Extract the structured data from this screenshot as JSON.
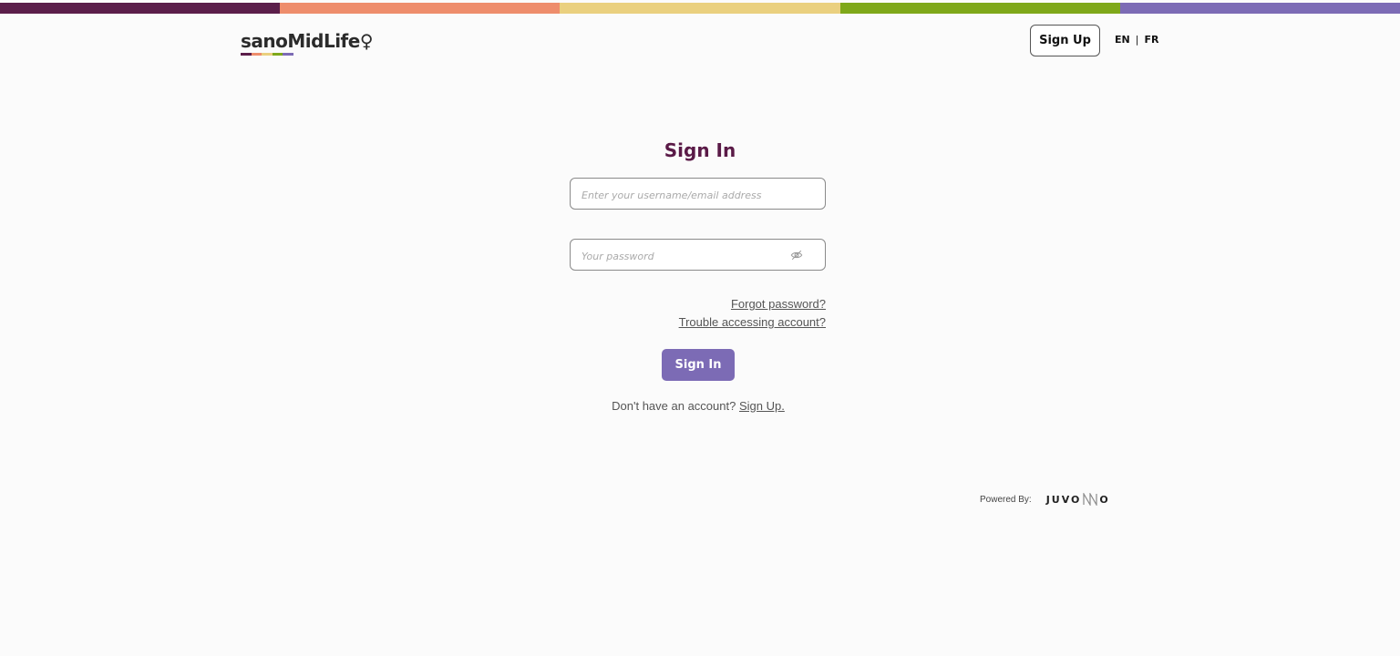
{
  "colors": {
    "stripe": [
      "#5b1e4a",
      "#ee8d6c",
      "#ead07f",
      "#7fa81a",
      "#7c6bb5"
    ],
    "title": "#5a1a47",
    "button": "#7c6bb5"
  },
  "header": {
    "logo_text": "sanoMidLife",
    "logo_symbol": "♀",
    "signup_label": "Sign Up",
    "lang_en": "EN",
    "lang_sep": "|",
    "lang_fr": "FR"
  },
  "form": {
    "title": "Sign In",
    "username_placeholder": "Enter your username/email address",
    "password_placeholder": "Your password",
    "forgot_password": "Forgot password?",
    "trouble_access": "Trouble accessing account?",
    "submit_label": "Sign In",
    "no_account_text": "Don't have an account?",
    "signup_link": "Sign Up."
  },
  "footer": {
    "powered_by": "Powered By:",
    "brand_left": "JUVO",
    "brand_right": "O"
  },
  "icons": {
    "password_toggle": "eye-slash-icon"
  }
}
